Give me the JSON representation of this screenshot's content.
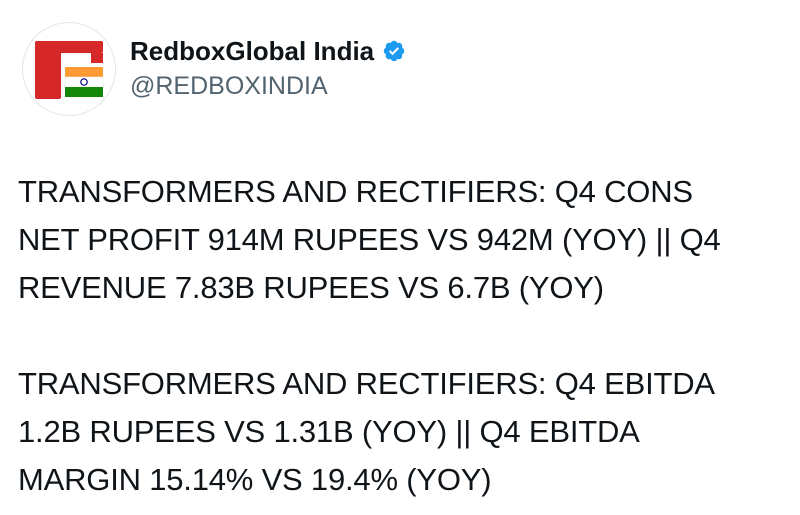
{
  "tweet": {
    "author": {
      "display_name": "RedboxGlobal India",
      "handle": "@REDBOXINDIA",
      "verified": true,
      "avatar_icon": "redbox-india-logo-icon",
      "verified_icon": "verified-badge-icon"
    },
    "paragraphs": [
      "TRANSFORMERS AND RECTIFIERS: Q4 CONS\nNET PROFIT 914M RUPEES VS 942M (YOY) || Q4\nREVENUE 7.83B RUPEES VS 6.7B (YOY)",
      "TRANSFORMERS AND RECTIFIERS: Q4 EBITDA\n1.2B RUPEES VS 1.31B (YOY) || Q4 EBITDA\nMARGIN 15.14% VS 19.4% (YOY)"
    ]
  },
  "colors": {
    "text": "#0f1419",
    "handle": "#536471",
    "verified": "#1d9bf0",
    "brand_red": "#d62828",
    "saffron": "#ff9933",
    "india_green": "#138808",
    "chakra": "#000080"
  }
}
